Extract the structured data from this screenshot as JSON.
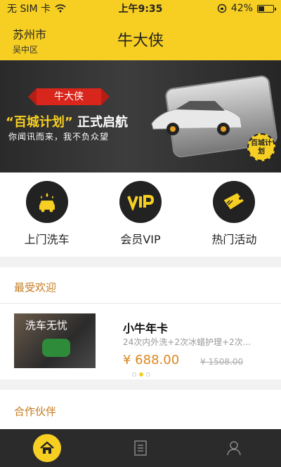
{
  "status_bar": {
    "carrier": "无 SIM 卡",
    "time": "上午9:35",
    "battery": "42%",
    "battery_level": 0.42
  },
  "header": {
    "city": "苏州市",
    "district": "吴中区",
    "title": "牛大侠"
  },
  "banner": {
    "ribbon": "牛大侠",
    "headline_quoted": "“百城计划”",
    "headline_rest": " 正式启航",
    "subline": "你闻讯而来，我不负众望",
    "seal_text": "百城计划"
  },
  "services": [
    {
      "label": "上门洗车",
      "icon": "car-wash-icon"
    },
    {
      "label": "会员VIP",
      "icon": "vip-icon"
    },
    {
      "label": "热门活动",
      "icon": "hot-tag-icon"
    }
  ],
  "favorites": {
    "section_title": "最受欢迎",
    "product": {
      "thumb_text": "洗车无忧",
      "name": "小牛年卡",
      "desc": "24次内外洗+2次冰蜡护理+2次...",
      "price": "¥ 688.00",
      "old_price": "¥ 1508.00"
    }
  },
  "partners": {
    "section_title": "合作伙伴"
  },
  "tabbar": [
    {
      "name": "home",
      "icon": "home-icon"
    },
    {
      "name": "orders",
      "icon": "list-icon"
    },
    {
      "name": "profile",
      "icon": "user-icon"
    }
  ],
  "colors": {
    "accent": "#f7cf22",
    "section_title": "#c47a1e",
    "price": "#d9861c",
    "tabbar": "#2b2b2b"
  }
}
